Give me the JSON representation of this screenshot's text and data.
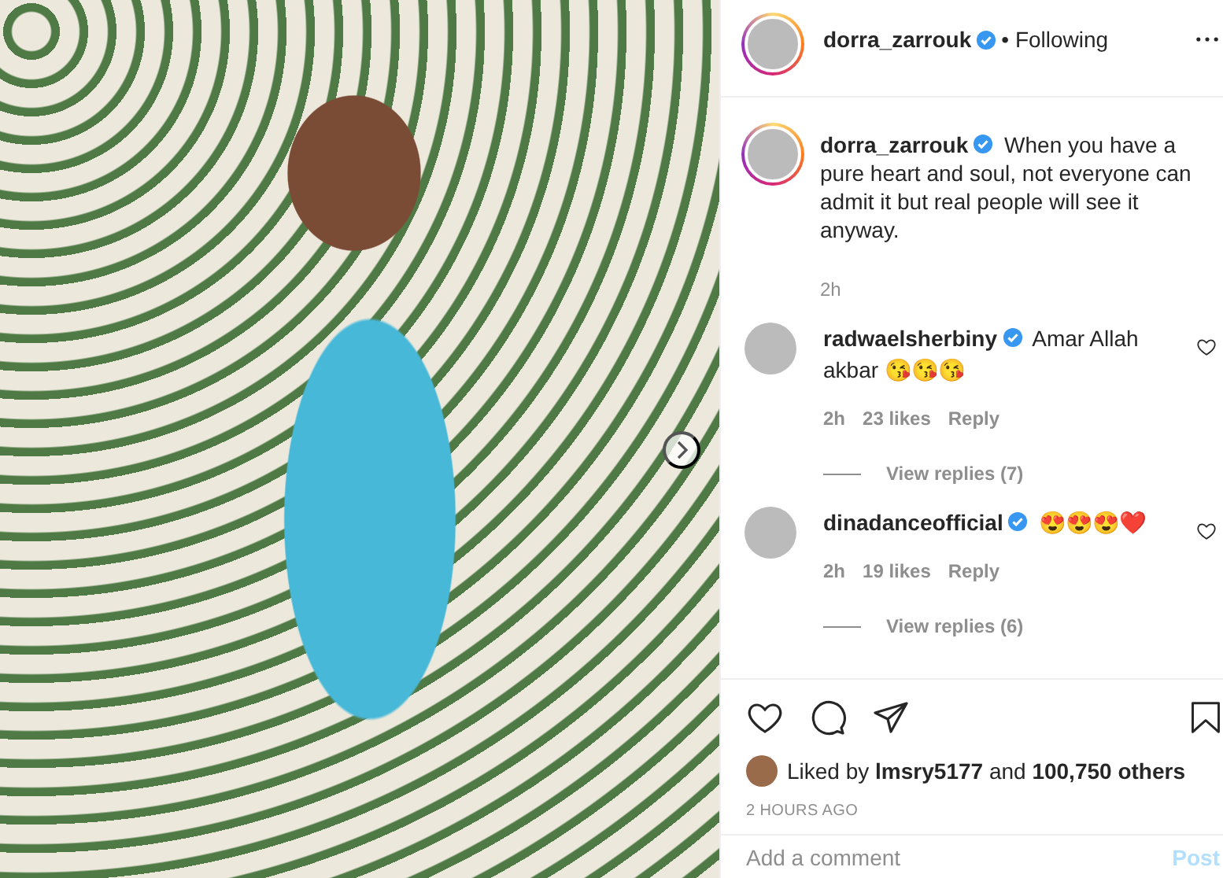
{
  "header": {
    "username": "dorra_zarrouk",
    "verified": true,
    "follow_status": "• Following"
  },
  "caption": {
    "username": "dorra_zarrouk",
    "verified": true,
    "text": "When you have a pure heart and soul, not everyone can admit it but real people will see it anyway.",
    "time": "2h"
  },
  "comments": [
    {
      "username": "radwaelsherbiny",
      "verified": true,
      "text": "Amar Allah akbar 😘😘😘",
      "time": "2h",
      "likes": "23 likes",
      "reply": "Reply",
      "view_replies": "View replies (7)",
      "liked": false
    },
    {
      "username": "dinadanceofficial",
      "verified": true,
      "text": "😍😍😍❤️",
      "time": "2h",
      "likes": "19 likes",
      "reply": "Reply",
      "view_replies": "View replies (6)",
      "liked": false
    }
  ],
  "actions": {
    "liked": false,
    "saved": false,
    "liked_by": "Liked by **lmsry5177** and **100,750 others**",
    "timestamp": "2 HOURS AGO"
  },
  "comment_box": {
    "placeholder": "Add a comment",
    "post": "Post"
  }
}
